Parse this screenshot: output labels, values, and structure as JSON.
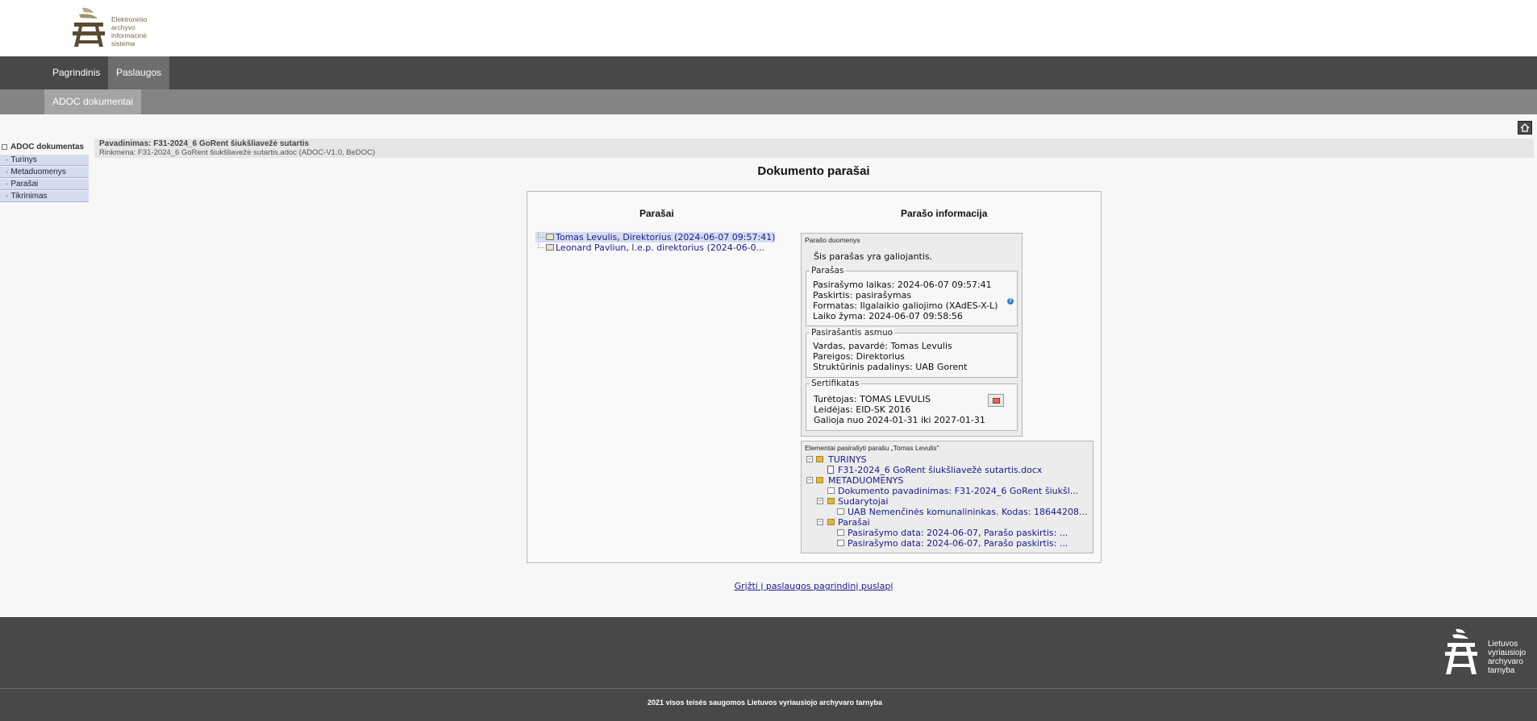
{
  "header": {
    "logo_lines": [
      "Elektroninio",
      "archyvo",
      "informacinė",
      "sistema"
    ]
  },
  "main_nav": {
    "items": [
      "Pagrindinis",
      "Paslaugos"
    ],
    "active": "Paslaugos"
  },
  "sub_nav": {
    "items": [
      "ADOC dokumentai"
    ]
  },
  "left_menu": {
    "title": "ADOC dokumentas",
    "items": [
      "Turinys",
      "Metaduomenys",
      "Parašai",
      "Tikrinimas"
    ]
  },
  "doc_info": {
    "name_line": "Pavadinimas: F31-2024_6 GoRent šiukšliavežė sutartis",
    "file_line": "Rinkmena: F31-2024_6 GoRent šiukšliavežė sutartis.adoc (ADOC-V1.0, BeDOC)"
  },
  "page_title": "Dokumento parašai",
  "signatures": {
    "heading": "Parašai",
    "list": [
      "Tomas Levulis, Direktorius (2024-06-07 09:57:41)",
      "Leonard Pavliun, l.e.p. direktorius (2024-06-0..."
    ]
  },
  "signature_info": {
    "heading": "Parašo informacija",
    "data_caption": "Parašo duomenys",
    "valid_text": "Šis parašas yra galiojantis.",
    "signature_group": {
      "legend": "Parašas",
      "lines": [
        "Pasirašymo laikas: 2024-06-07 09:57:41",
        "Paskirtis: pasirašymas",
        "Formatas: Ilgalaikio galiojimo (XAdES-X-L)",
        "Laiko žyma: 2024-06-07 09:58:56"
      ],
      "help_icon": "?"
    },
    "signer_group": {
      "legend": "Pasirašantis asmuo",
      "lines": [
        "Vardas, pavardė: Tomas Levulis",
        "Pareigos: Direktorius",
        "Struktūrinis padalinys: UAB Gorent"
      ]
    },
    "certificate_group": {
      "legend": "Sertifikatas",
      "lines": [
        "Turėtojas: TOMAS LEVULIS",
        "Leidėjas: EID-SK 2016",
        "Galioja nuo 2024-01-31 iki 2027-01-31"
      ]
    }
  },
  "signed_elements": {
    "caption": "Elementai pasirašyti parašu „Tomas Levulis\"",
    "tree": [
      "TURINYS",
      "F31-2024_6 GoRent šiukšliavežė sutartis.docx",
      "METADUOMENYS",
      "Dokumento pavadinimas: F31-2024_6 GoRent šiukšl...",
      "Sudarytojai",
      "UAB Nemenčinės komunalininkas. Kodas: 18644208...",
      "Parašai",
      "Pasirašymo data: 2024-06-07, Parašo paskirtis: ...",
      "Pasirašymo data: 2024-06-07, Parašo paskirtis: ..."
    ]
  },
  "back_link": "Grįžti į paslaugos pagrindinį puslapį",
  "footer": {
    "logo_lines": [
      "Lietuvos",
      "vyriausiojo",
      "archyvaro",
      "tarnyba"
    ],
    "copyright": "2021 visos teisės saugomos Lietuvos vyriausiojo archyvaro tarnyba"
  },
  "colors": {
    "nav_bg": "#484848",
    "nav_active": "#6e6e6e",
    "subnav_bg": "#848484",
    "link": "#1a1a8c",
    "menu_item_bg": "#d6dcf0",
    "logo_brown": "#7a6a45"
  }
}
